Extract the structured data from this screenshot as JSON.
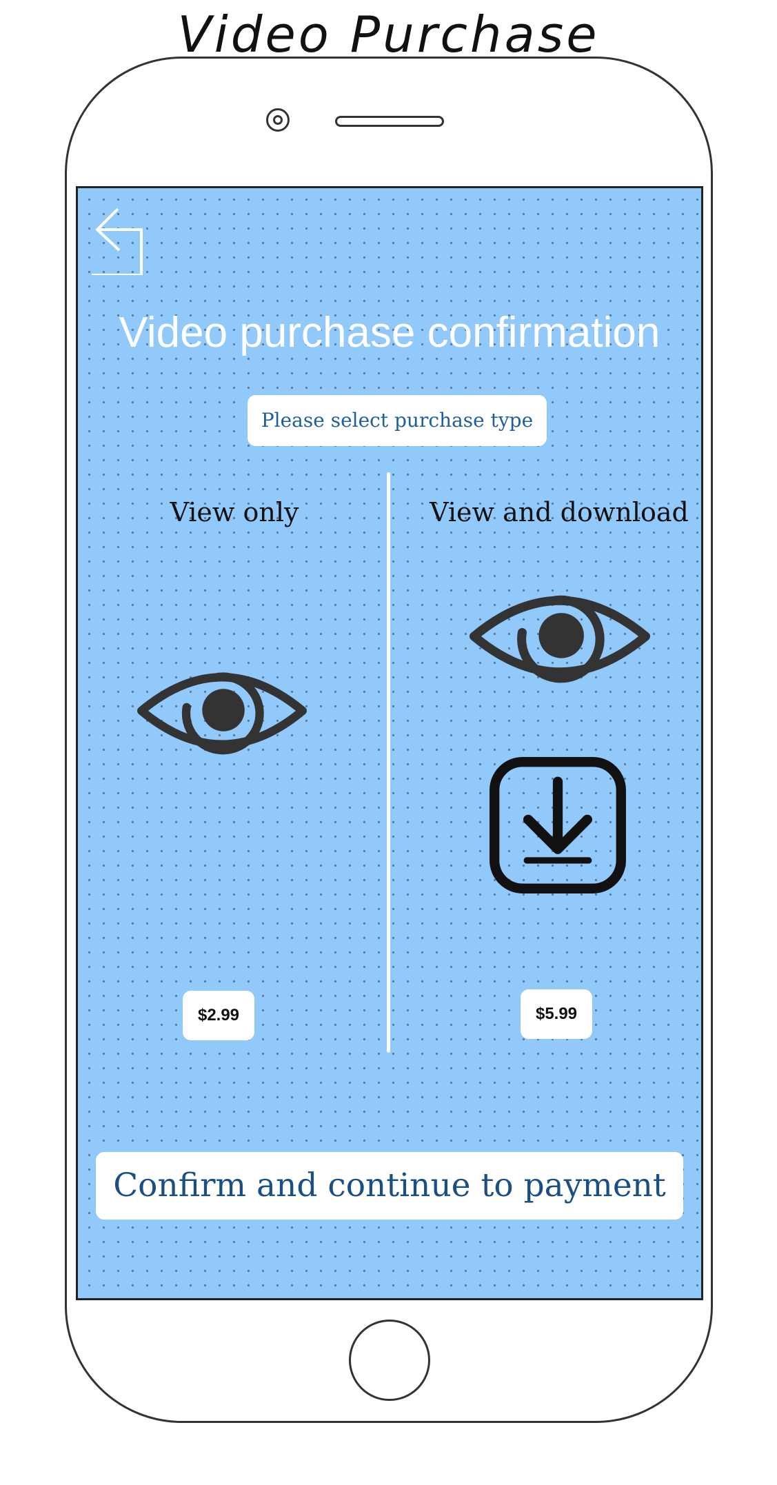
{
  "sketch": {
    "title": "Video Purchase"
  },
  "screen": {
    "title": "Video purchase confirmation",
    "select_prompt": "Please select purchase type",
    "options": [
      {
        "label": "View only",
        "price": "$2.99",
        "icons": [
          "eye-icon"
        ]
      },
      {
        "label": "View and download",
        "price": "$5.99",
        "icons": [
          "eye-icon",
          "download-icon"
        ]
      }
    ],
    "confirm_label": "Confirm and continue to payment"
  },
  "colors": {
    "screen_bg": "#91c9fb",
    "accent_text": "#1d5f9e",
    "icon": "#333333"
  }
}
